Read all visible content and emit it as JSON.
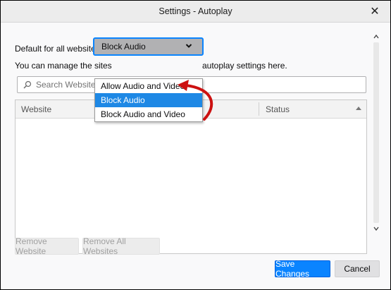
{
  "window": {
    "title": "Settings - Autoplay",
    "close_glyph": "✕"
  },
  "default_setting": {
    "label": "Default for all websites:",
    "selected_value": "Block Audio",
    "options": [
      "Allow Audio and Video",
      "Block Audio",
      "Block Audio and Video"
    ],
    "highlighted_option": "Block Audio"
  },
  "manage_text": {
    "before": "You can manage the sites",
    "after": "autoplay settings here."
  },
  "search": {
    "placeholder": "Search Website",
    "value": ""
  },
  "table": {
    "columns": [
      "Website",
      "Status"
    ],
    "rows": []
  },
  "buttons": {
    "remove_website": "Remove Website",
    "remove_all": "Remove All Websites",
    "save": "Save Changes",
    "cancel": "Cancel"
  },
  "colors": {
    "accent": "#0a84ff",
    "annotation_arrow": "#cc1111"
  }
}
